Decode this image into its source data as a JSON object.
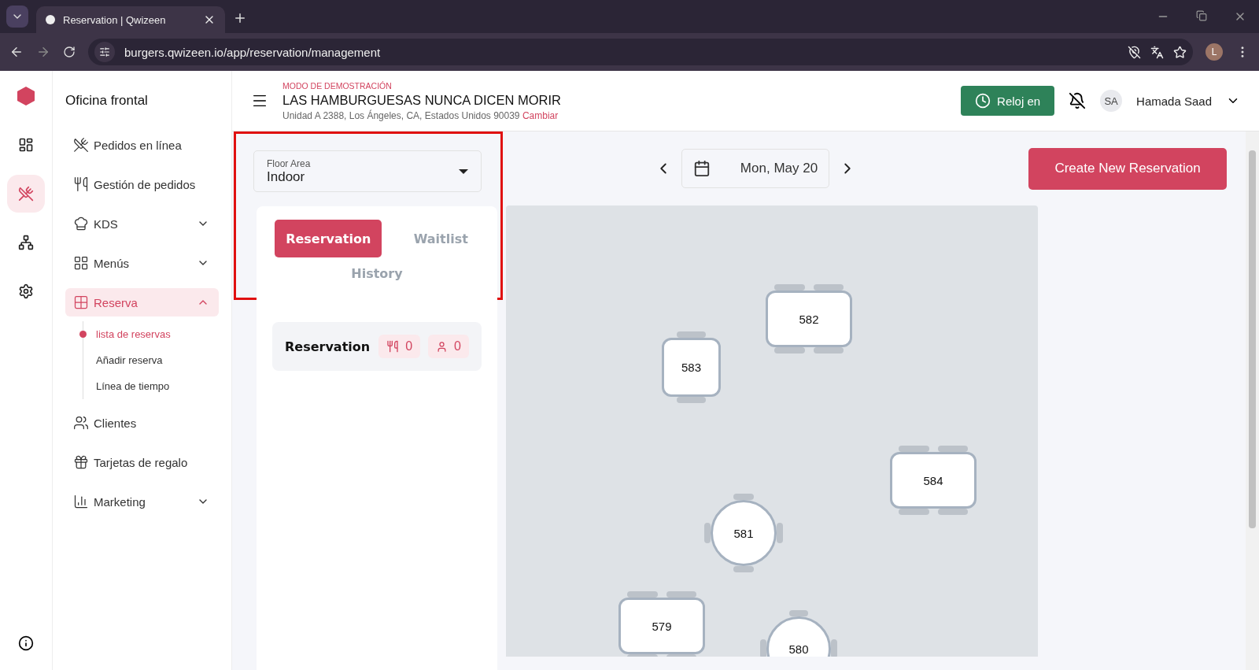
{
  "browser": {
    "tab_title": "Reservation | Qwizeen",
    "url": "burgers.qwizeen.io/app/reservation/management",
    "profile_initial": "L"
  },
  "rail": [
    {
      "selected": false
    },
    {
      "selected": true
    },
    {
      "selected": false
    },
    {
      "selected": false
    }
  ],
  "sidebar": {
    "title": "Oficina frontal",
    "items": [
      {
        "label": "Pedidos en línea",
        "selected": false
      },
      {
        "label": "Gestión de pedidos",
        "selected": false
      },
      {
        "label": "KDS",
        "selected": false,
        "expanded": false
      },
      {
        "label": "Menús",
        "selected": false,
        "expanded": false
      },
      {
        "label": "Reserva",
        "selected": true,
        "expanded": true,
        "children": [
          {
            "label": "lista de reservas",
            "selected": true
          },
          {
            "label": "Añadir reserva",
            "selected": false
          },
          {
            "label": "Línea de tiempo",
            "selected": false
          }
        ]
      },
      {
        "label": "Clientes",
        "selected": false
      },
      {
        "label": "Tarjetas de regalo",
        "selected": false
      },
      {
        "label": "Marketing",
        "selected": false,
        "expanded": false
      }
    ]
  },
  "header": {
    "demo_label": "MODO DE DEMOSTRACIÓN",
    "restaurant": "LAS HAMBURGUESAS NUNCA DICEN MORIR",
    "address": "Unidad A 2388, Los Ángeles, CA, Estados Unidos 90039",
    "change_link": "Cambiar",
    "clock_button": "Reloj en",
    "user_initials": "SA",
    "user_name": "Hamada Saad"
  },
  "floor_area": {
    "label": "Floor Area",
    "value": "Indoor"
  },
  "tabs": [
    {
      "label": "Reservation",
      "selected": true
    },
    {
      "label": "Waitlist",
      "selected": false
    },
    {
      "label": "History",
      "selected": false
    }
  ],
  "summary": {
    "title": "Reservation",
    "tables_count": "0",
    "guests_count": "0"
  },
  "date": "Mon, May 20",
  "create_button": "Create New Reservation",
  "tables": [
    {
      "number": "582",
      "kind": "rect"
    },
    {
      "number": "583",
      "kind": "square"
    },
    {
      "number": "584",
      "kind": "rect"
    },
    {
      "number": "581",
      "kind": "round"
    },
    {
      "number": "579",
      "kind": "rect"
    },
    {
      "number": "580",
      "kind": "round"
    }
  ]
}
